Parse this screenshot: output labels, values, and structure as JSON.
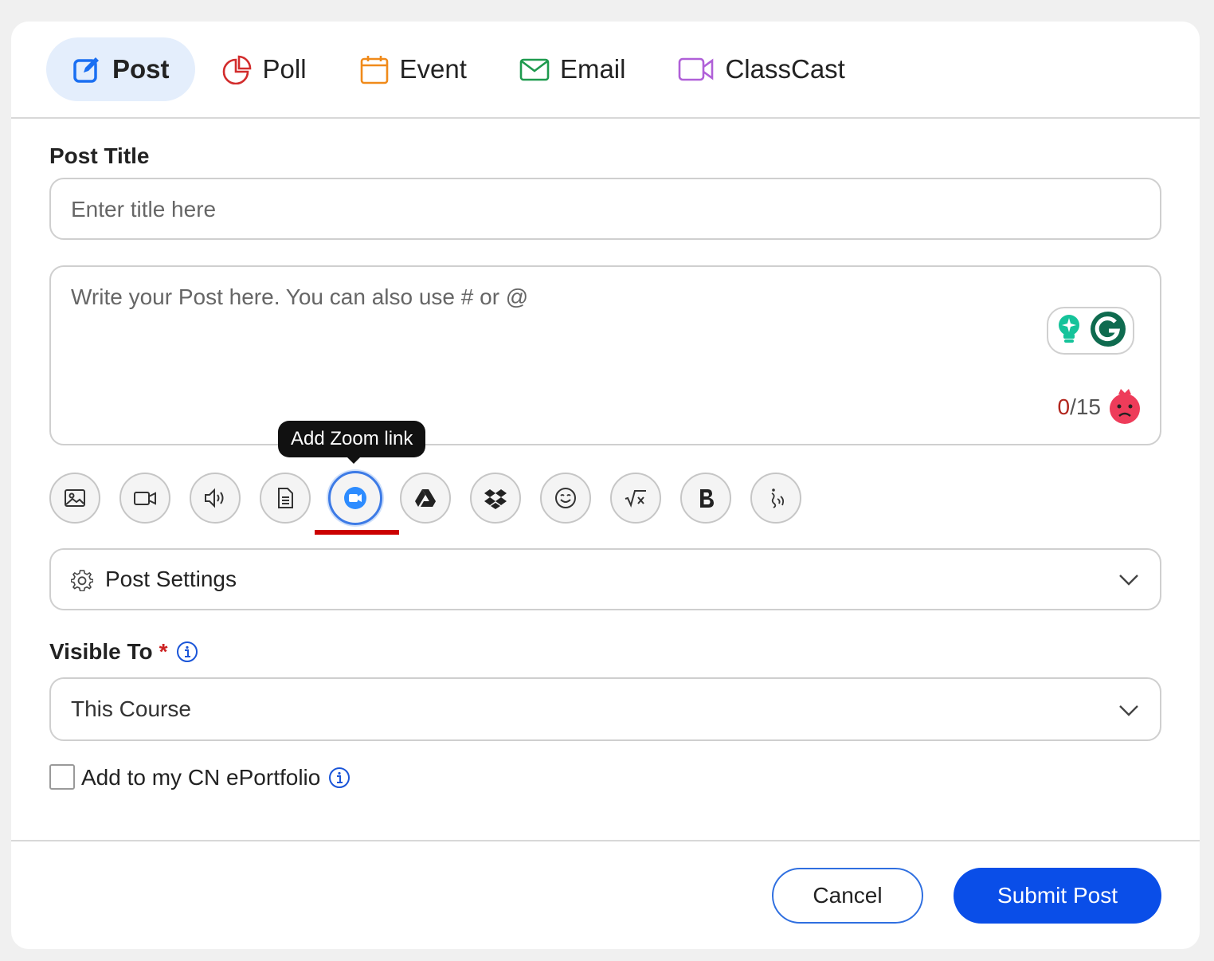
{
  "tabs": [
    {
      "label": "Post",
      "icon": "edit-icon",
      "active": true
    },
    {
      "label": "Poll",
      "icon": "pie-chart-icon"
    },
    {
      "label": "Event",
      "icon": "calendar-icon"
    },
    {
      "label": "Email",
      "icon": "envelope-icon"
    },
    {
      "label": "ClassCast",
      "icon": "video-camera-icon"
    }
  ],
  "post_title": {
    "label": "Post Title",
    "placeholder": "Enter title here"
  },
  "body": {
    "placeholder": "Write your Post here. You can also use # or @",
    "counter_current": "0",
    "counter_total": "/15"
  },
  "tooltip": "Add Zoom link",
  "toolbar": [
    "image-icon",
    "video-icon",
    "audio-icon",
    "document-icon",
    "zoom-icon",
    "google-drive-icon",
    "dropbox-icon",
    "emoji-icon",
    "math-icon",
    "bold-icon",
    "handwriting-icon"
  ],
  "post_settings": {
    "label": "Post Settings"
  },
  "visible_to": {
    "label": "Visible To",
    "required_mark": "*",
    "value": "This Course"
  },
  "eportfolio": {
    "label": "Add to my CN ePortfolio",
    "checked": false
  },
  "footer": {
    "cancel_label": "Cancel",
    "submit_label": "Submit Post"
  },
  "colors": {
    "accent": "#0a4ee8",
    "active_tab_bg": "#e4eefc",
    "required": "#cc2222",
    "zoom_highlight": "#cc0000"
  }
}
